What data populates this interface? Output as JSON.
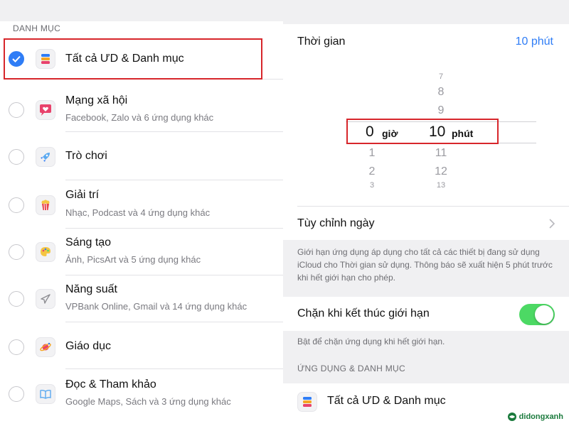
{
  "categories": {
    "section_title": "DANH MỤC",
    "items": [
      {
        "title": "Tất cả ƯD & Danh mục",
        "subtitle": "",
        "checked": true,
        "icon": "stack-icon"
      },
      {
        "title": "Mạng xã hội",
        "subtitle": "Facebook, Zalo và 6 ứng dụng khác",
        "checked": false,
        "icon": "chat-heart-icon"
      },
      {
        "title": "Trò chơi",
        "subtitle": "",
        "checked": false,
        "icon": "rocket-icon"
      },
      {
        "title": "Giải trí",
        "subtitle": "Nhạc, Podcast và 4 ứng dụng khác",
        "checked": false,
        "icon": "popcorn-icon"
      },
      {
        "title": "Sáng tạo",
        "subtitle": "Ảnh, PicsArt và 5 ứng dụng khác",
        "checked": false,
        "icon": "palette-icon"
      },
      {
        "title": "Năng suất",
        "subtitle": "VPBank Online, Gmail và 14 ứng dụng khác",
        "checked": false,
        "icon": "paper-plane-icon"
      },
      {
        "title": "Giáo dục",
        "subtitle": "",
        "checked": false,
        "icon": "planet-icon"
      },
      {
        "title": "Đọc & Tham khảo",
        "subtitle": "Google Maps, Sách và 3 ứng dụng khác",
        "checked": false,
        "icon": "book-icon"
      }
    ]
  },
  "time": {
    "label": "Thời gian",
    "value": "10 phút",
    "picker": {
      "minutes_above": [
        "7",
        "8",
        "9"
      ],
      "hours_below": [
        "1",
        "2",
        "3"
      ],
      "minutes_below": [
        "11",
        "12",
        "13"
      ],
      "selected_hours": "0",
      "hours_unit": "giờ",
      "selected_minutes": "10",
      "minutes_unit": "phút"
    }
  },
  "customize_days": {
    "label": "Tùy chỉnh ngày"
  },
  "limit_note": "Giới hạn ứng dụng áp dụng cho tất cả các thiết bị đang sử dụng iCloud cho Thời gian sử dụng. Thông báo sẽ xuất hiện 5 phút trước khi hết giới hạn cho phép.",
  "block": {
    "label": "Chặn khi kết thúc giới hạn",
    "enabled": true,
    "note": "Bật để chặn ứng dụng khi hết giới hạn."
  },
  "apps_section": {
    "title": "ỨNG DỤNG & DANH MỤC",
    "item": "Tất cả ƯD & Danh mục"
  },
  "brand": {
    "name": "didongxanh"
  },
  "colors": {
    "accent": "#2f7df6",
    "highlight": "#d7262b",
    "toggle_on": "#4cd964"
  }
}
